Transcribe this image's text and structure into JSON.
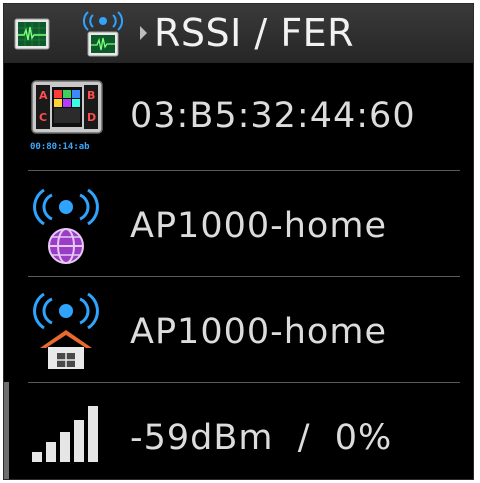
{
  "header": {
    "title": "RSSI / FER",
    "icons": [
      "monitor-waveform-icon",
      "network-waveform-icon",
      "breadcrumb-arrow-icon"
    ]
  },
  "rows": [
    {
      "icon": "device-panel-icon",
      "icon_caption": "00:80:14:ab",
      "text": "03:B5:32:44:60"
    },
    {
      "icon": "wireless-globe-icon",
      "text": "AP1000-home"
    },
    {
      "icon": "wireless-home-icon",
      "text": "AP1000-home"
    },
    {
      "icon": "signal-bars-icon",
      "text": "-59dBm  /  0%"
    }
  ],
  "colors": {
    "background": "#000000",
    "header": "#2e2e2e",
    "text": "#dcdcdc",
    "title": "#f2f2f2",
    "accent_blue": "#3aa8ff",
    "divider": "#5a5a5a"
  }
}
